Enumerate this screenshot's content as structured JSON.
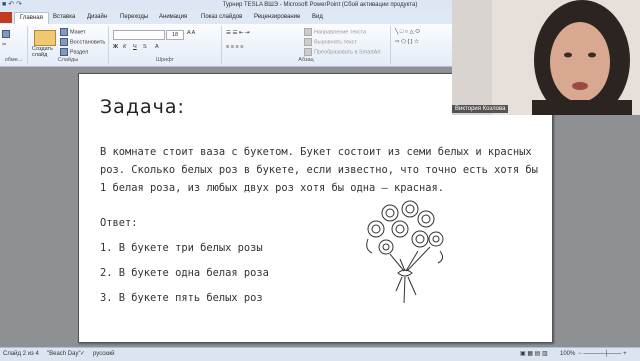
{
  "window": {
    "title": "Турнир TESLA ВШЭ - Microsoft PowerPoint (Сбой активации продукта)"
  },
  "tabs": [
    {
      "label": ""
    },
    {
      "label": "Главная"
    },
    {
      "label": "Вставка"
    },
    {
      "label": "Дизайн"
    },
    {
      "label": "Переходы"
    },
    {
      "label": "Анимация"
    },
    {
      "label": "Показ слайдов"
    },
    {
      "label": "Рецензирование"
    },
    {
      "label": "Вид"
    }
  ],
  "ribbon": {
    "slides_group": {
      "label": "Слайды",
      "create_slide": "Создать слайд",
      "layout": "Макет",
      "reset": "Восстановить",
      "section": "Раздел"
    },
    "clipboard_label": "обме...",
    "font_group": {
      "label": "Шрифт",
      "size": "18"
    },
    "paragraph_group": {
      "label": "Абзац",
      "text_direction": "Направление текста",
      "align_text": "Выровнять текст",
      "smartart": "Преобразовать в SmartArt"
    }
  },
  "slide": {
    "title": "Задача:",
    "body": "В комнате стоит ваза с букетом. Букет состоит из семи белых и красных роз. Сколько белых роз в букете, если известно, что точно есть хотя бы 1 белая роза, из любых двух роз хотя бы одна – красная.",
    "answer_label": "Ответ:",
    "options": [
      "1. В букете три белых розы",
      "2. В букете одна белая роза",
      "3. В букете пять белых роз"
    ]
  },
  "webcam": {
    "name": "Виктория Козлова"
  },
  "status": {
    "slide": "Слайд 2 из 4",
    "theme": "\"Beach Day\"",
    "language": "русский",
    "zoom": "100%"
  },
  "colors": {
    "file_tab": "#c13c1f",
    "ribbon_bg": "#e4ecf7"
  }
}
